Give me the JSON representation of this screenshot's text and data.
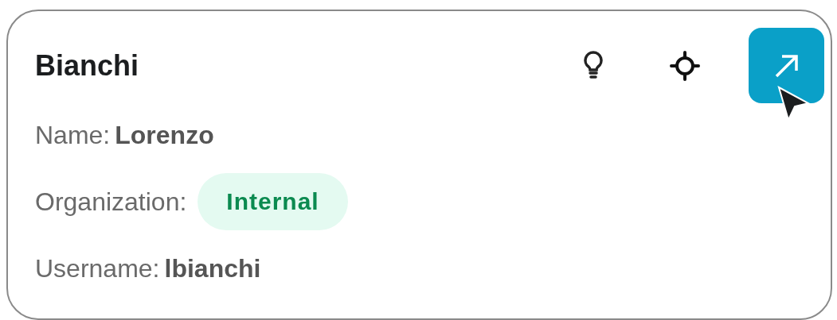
{
  "card": {
    "title": "Bianchi",
    "fields": [
      {
        "kind": "text",
        "label": "Name:",
        "value": "Lorenzo"
      },
      {
        "kind": "badge",
        "label": "Organization:",
        "value": "Internal"
      },
      {
        "kind": "text",
        "label": "Username:",
        "value": "lbianchi"
      }
    ]
  }
}
